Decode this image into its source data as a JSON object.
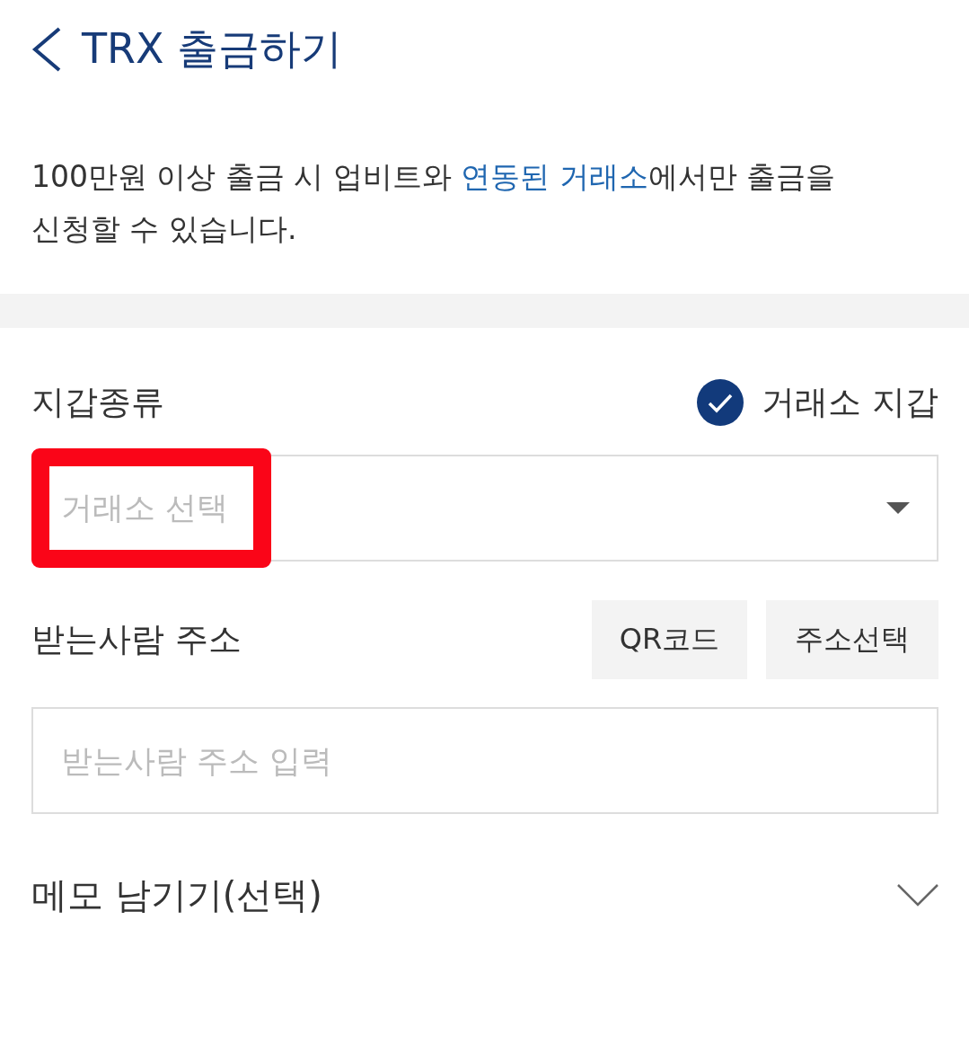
{
  "header": {
    "title": "TRX 출금하기"
  },
  "notice": {
    "before": "100만원 이상 출금 시 업비트와 ",
    "link": "연동된 거래소",
    "after": "에서만 출금을 신청할 수 있습니다."
  },
  "wallet_type": {
    "label": "지갑종류",
    "option": {
      "label": "거래소 지갑",
      "checked": true
    },
    "select": {
      "placeholder": "거래소 선택",
      "highlighted": true
    }
  },
  "recipient": {
    "label": "받는사람 주소",
    "buttons": [
      "QR코드",
      "주소선택"
    ],
    "input": {
      "placeholder": "받는사람 주소 입력"
    }
  },
  "memo": {
    "label": "메모 남기기(선택)",
    "expanded": false
  }
}
